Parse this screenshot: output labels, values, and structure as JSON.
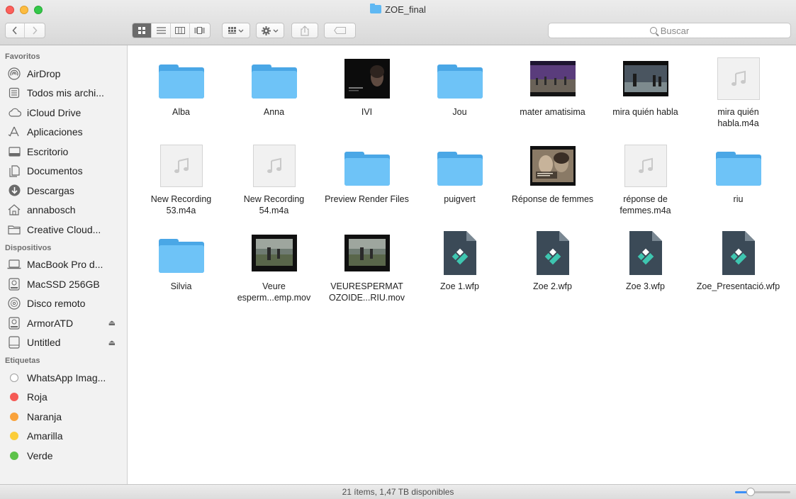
{
  "window": {
    "title": "ZOE_final"
  },
  "toolbar": {
    "back_icon": "chevron-left-icon",
    "forward_icon": "chevron-right-icon",
    "view_modes": [
      "icon-view",
      "list-view",
      "column-view",
      "cover-flow-view"
    ],
    "selected_view": "icon-view",
    "search_placeholder": "Buscar"
  },
  "sidebar": {
    "sections": [
      {
        "title": "Favoritos",
        "items": [
          {
            "label": "AirDrop",
            "icon": "airdrop-icon"
          },
          {
            "label": "Todos mis archi...",
            "icon": "all-files-icon"
          },
          {
            "label": "iCloud Drive",
            "icon": "cloud-icon"
          },
          {
            "label": "Aplicaciones",
            "icon": "applications-icon"
          },
          {
            "label": "Escritorio",
            "icon": "desktop-icon"
          },
          {
            "label": "Documentos",
            "icon": "documents-icon"
          },
          {
            "label": "Descargas",
            "icon": "downloads-icon"
          },
          {
            "label": "annabosch",
            "icon": "home-icon"
          },
          {
            "label": "Creative Cloud...",
            "icon": "folder-icon"
          }
        ]
      },
      {
        "title": "Dispositivos",
        "items": [
          {
            "label": "MacBook Pro d...",
            "icon": "laptop-icon"
          },
          {
            "label": "MacSSD 256GB",
            "icon": "disk-icon"
          },
          {
            "label": "Disco remoto",
            "icon": "remote-disc-icon"
          },
          {
            "label": "ArmorATD",
            "icon": "disk-icon",
            "eject": true
          },
          {
            "label": "Untitled",
            "icon": "external-drive-icon",
            "eject": true
          }
        ]
      },
      {
        "title": "Etiquetas",
        "items": [
          {
            "label": "WhatsApp Imag...",
            "color": "#ffffff"
          },
          {
            "label": "Roja",
            "color": "#f55a55"
          },
          {
            "label": "Naranja",
            "color": "#f9a23b"
          },
          {
            "label": "Amarilla",
            "color": "#fbcd3a"
          },
          {
            "label": "Verde",
            "color": "#5dc24a"
          }
        ]
      }
    ]
  },
  "files": [
    {
      "name": "Alba",
      "kind": "folder"
    },
    {
      "name": "Anna",
      "kind": "folder"
    },
    {
      "name": "IVI",
      "kind": "video-thumb",
      "variant": "dark-portrait"
    },
    {
      "name": "Jou",
      "kind": "folder"
    },
    {
      "name": "mater amatisima",
      "kind": "video-thumb",
      "variant": "purple-crowd"
    },
    {
      "name": "mira quién habla",
      "kind": "video-thumb",
      "variant": "stage"
    },
    {
      "name": "mira quién habla.m4a",
      "kind": "audio"
    },
    {
      "name": "New Recording 53.m4a",
      "kind": "audio"
    },
    {
      "name": "New Recording 54.m4a",
      "kind": "audio"
    },
    {
      "name": "Preview Render Files",
      "kind": "folder"
    },
    {
      "name": "puigvert",
      "kind": "folder"
    },
    {
      "name": "Réponse de femmes",
      "kind": "video-thumb",
      "variant": "poster"
    },
    {
      "name": "réponse de femmes.m4a",
      "kind": "audio"
    },
    {
      "name": "riu",
      "kind": "folder"
    },
    {
      "name": "Silvia",
      "kind": "folder"
    },
    {
      "name": "Veure esperm...emp.mov",
      "kind": "video-thumb",
      "variant": "field"
    },
    {
      "name": "VEURESPERMAT OZOIDE...RIU.mov",
      "kind": "video-thumb",
      "variant": "field"
    },
    {
      "name": "Zoe 1.wfp",
      "kind": "wfp"
    },
    {
      "name": "Zoe 2.wfp",
      "kind": "wfp"
    },
    {
      "name": "Zoe 3.wfp",
      "kind": "wfp"
    },
    {
      "name": "Zoe_Presentació.wfp",
      "kind": "wfp"
    }
  ],
  "status": {
    "text": "21 ítems, 1,47 TB disponibles",
    "zoom": 0.28
  }
}
